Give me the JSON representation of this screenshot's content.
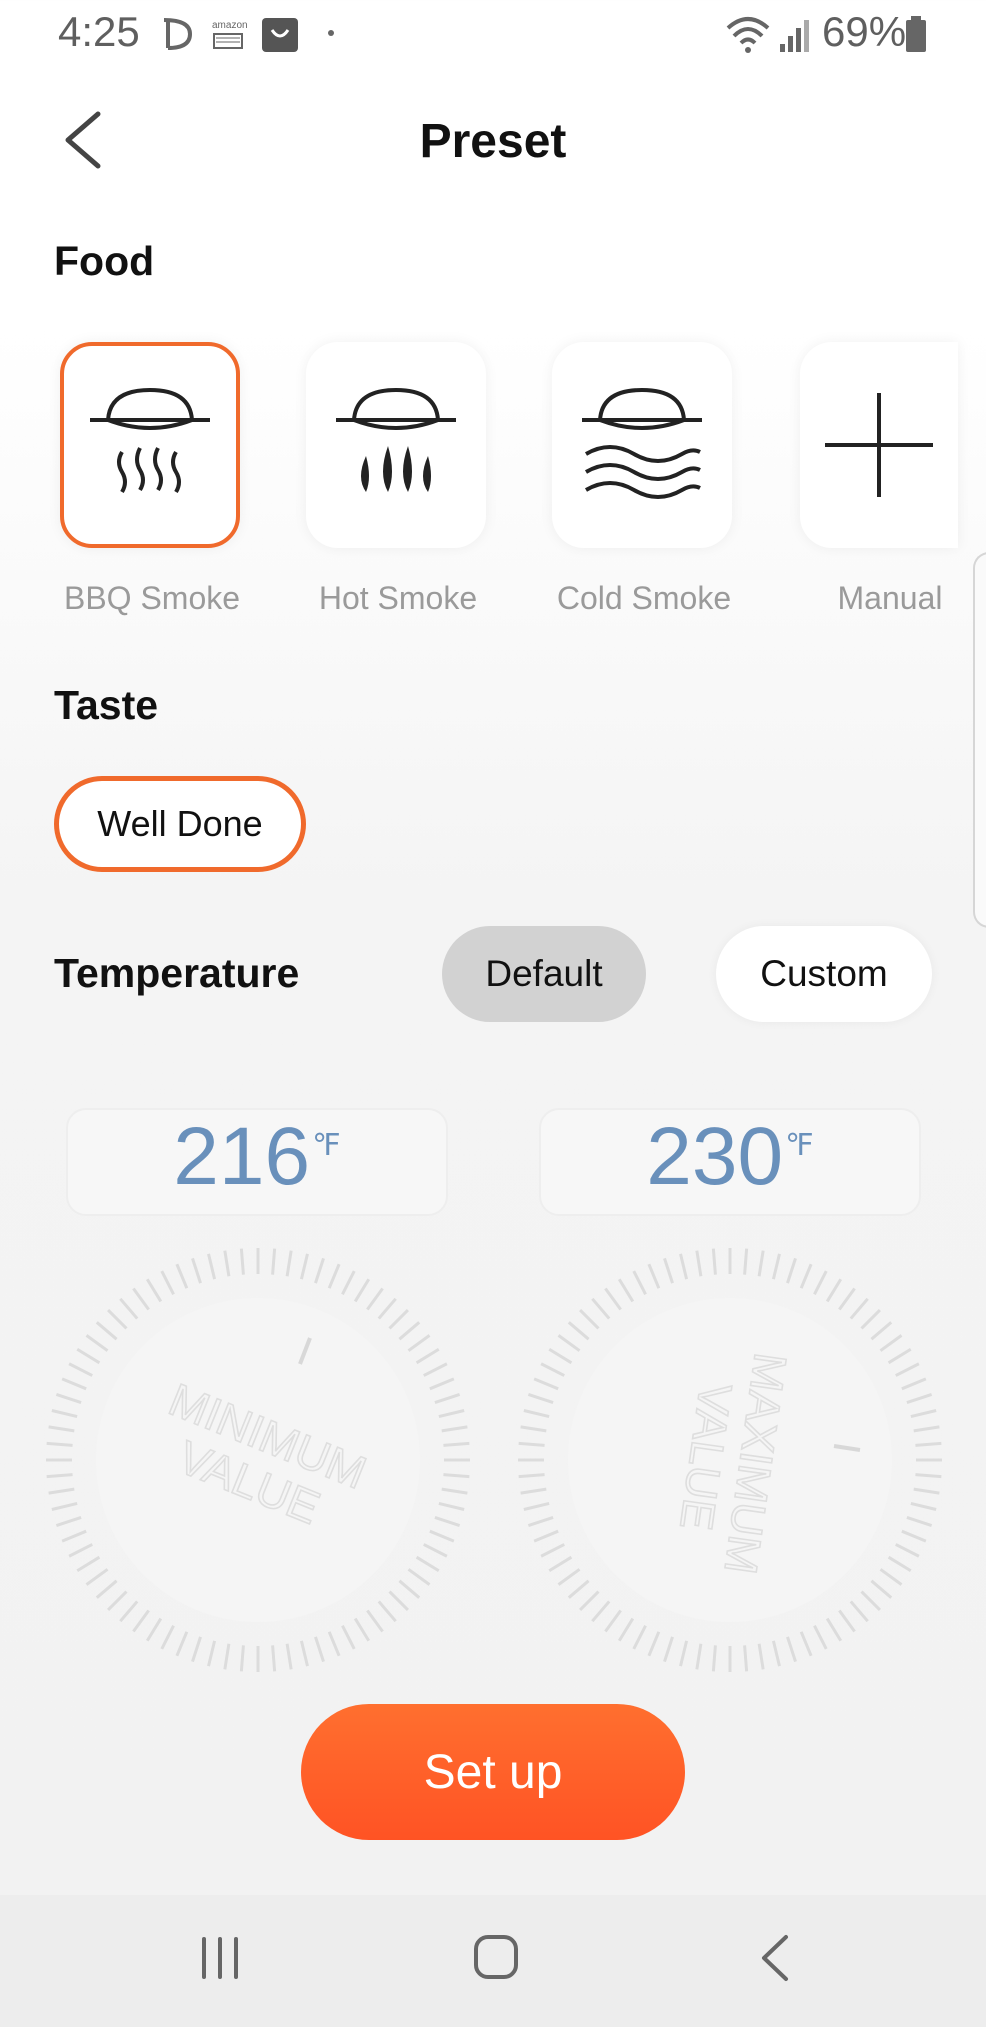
{
  "status_bar": {
    "time": "4:25",
    "battery": "69%",
    "icons": [
      "d-app-icon",
      "amazon-icon",
      "shopping-bag-icon",
      "dot-icon",
      "wifi-icon",
      "signal-icon",
      "battery-icon"
    ]
  },
  "header": {
    "title": "Preset",
    "back_icon": "chevron-left-icon"
  },
  "food": {
    "heading": "Food",
    "items": [
      {
        "label": "BBQ Smoke",
        "icon": "bbq-smoke-icon",
        "selected": true
      },
      {
        "label": "Hot Smoke",
        "icon": "hot-smoke-icon",
        "selected": false
      },
      {
        "label": "Cold Smoke",
        "icon": "cold-smoke-icon",
        "selected": false
      },
      {
        "label": "Manual",
        "icon": "plus-icon",
        "selected": false
      }
    ]
  },
  "taste": {
    "heading": "Taste",
    "selected": "Well Done"
  },
  "temperature": {
    "heading": "Temperature",
    "options": [
      "Default",
      "Custom"
    ],
    "active": "Default",
    "min": {
      "value": "216",
      "unit": "℉",
      "dial_label_1": "MINIMUM",
      "dial_label_2": "VALUE"
    },
    "max": {
      "value": "230",
      "unit": "℉",
      "dial_label_1": "MAXIMUM",
      "dial_label_2": "VALUE"
    }
  },
  "setup_button": "Set up",
  "nav": {
    "icons": [
      "recent-apps-icon",
      "home-icon",
      "back-icon"
    ]
  },
  "colors": {
    "accent": "#f06a2c",
    "button": "#ff5a28",
    "readout": "#6990bb",
    "toggle_active": "#d2d2d2"
  }
}
